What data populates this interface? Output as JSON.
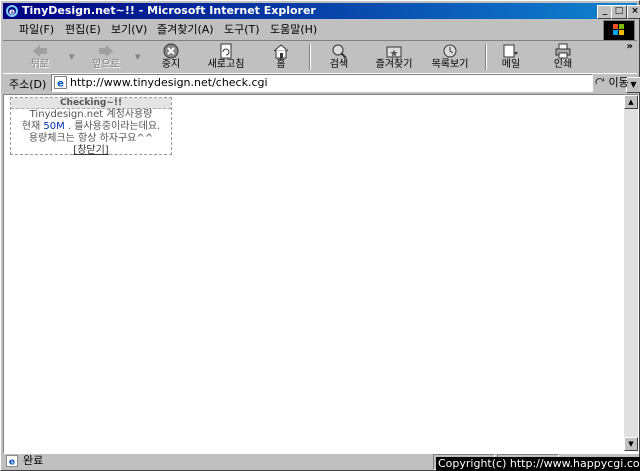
{
  "window": {
    "title": "TinyDesign.net~!! - Microsoft Internet Explorer",
    "minimize_glyph": "_",
    "maximize_glyph": "□",
    "close_glyph": "×"
  },
  "menu": [
    "파일(F)",
    "편집(E)",
    "보기(V)",
    "즐겨찾기(A)",
    "도구(T)",
    "도움말(H)"
  ],
  "toolbar": {
    "back": "뒤로",
    "forward": "앞으로",
    "stop": "중지",
    "refresh": "새로고침",
    "home": "홈",
    "search": "검색",
    "favorites": "즐겨찾기",
    "history": "목록보기",
    "mail": "메일",
    "print": "인쇄",
    "more": "»"
  },
  "address": {
    "label": "주소(D)",
    "url": "http://www.tinydesign.net/check.cgi",
    "go": "이동"
  },
  "content": {
    "header": "Checking~!!",
    "line1": "Tinydesign.net 계정사용량",
    "line2_prefix": "현재 ",
    "line2_value": "50M",
    "line2_suffix": " . 를사용중이라는데요.",
    "line3": "용량체크는 항상 하자구요^^",
    "close": "[창닫기]"
  },
  "status": {
    "text": "완료"
  },
  "copyright": "Copyright(c) http://www.happycgi.com"
}
